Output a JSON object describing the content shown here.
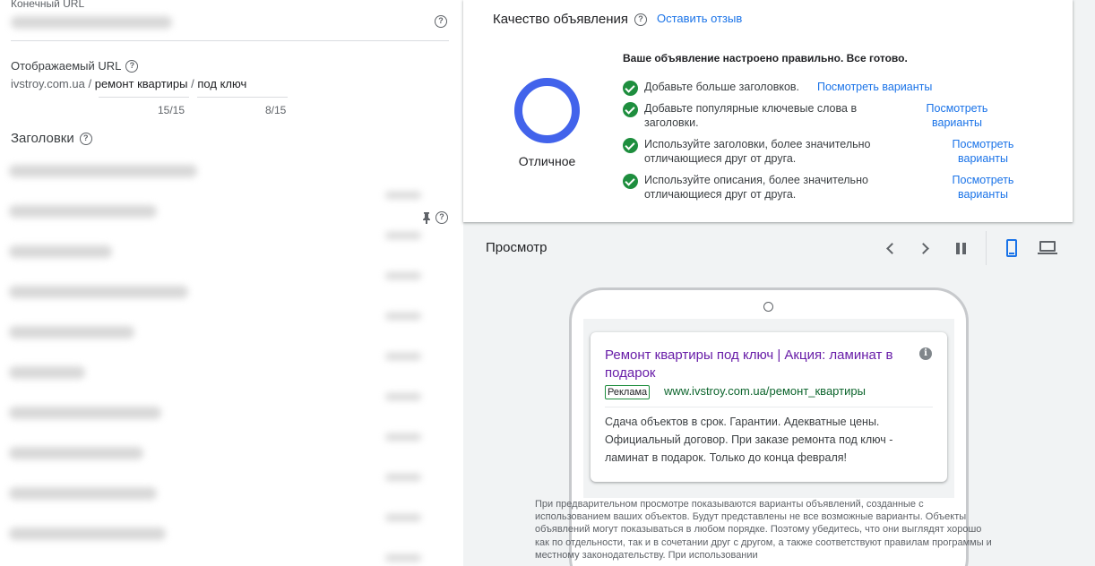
{
  "form": {
    "final_url_label": "Конечный URL",
    "display_url_label": "Отображаемый URL",
    "display_domain": "ivstroy.com.ua",
    "separator": "/",
    "path1": "ремонт квартиры",
    "path2": "под ключ",
    "path1_count": "15/15",
    "path2_count": "8/15",
    "headlines_label": "Заголовки"
  },
  "quality": {
    "title": "Качество объявления",
    "feedback_link": "Оставить отзыв",
    "rating": "Отличное",
    "heading": "Ваше объявление настроено правильно. Все готово.",
    "items": [
      {
        "text": "Добавьте больше заголовков.",
        "link": "Посмотреть варианты"
      },
      {
        "text": "Добавьте популярные ключевые слова в заголовки.",
        "link": "Посмотреть варианты"
      },
      {
        "text": "Используйте заголовки, более значительно отличающиеся друг от друга.",
        "link": "Посмотреть варианты"
      },
      {
        "text": "Используйте описания, более значительно отличающиеся друг от друга.",
        "link": "Посмотреть варианты"
      }
    ],
    "ring_color": "#4263eb",
    "check_color": "#1e8e3e"
  },
  "preview": {
    "title": "Просмотр",
    "controls": [
      "chevron-left-icon",
      "chevron-right-icon",
      "pause-icon",
      "mobile-icon",
      "laptop-icon"
    ],
    "ad": {
      "headline": "Ремонт квартиры под ключ | Акция: ламинат в подарок",
      "badge": "Реклама",
      "url": "www.ivstroy.com.ua/ремонт_квартиры",
      "description": "Сдача объектов в срок. Гарантии. Адекватные цены. Официальный договор. При заказе ремонта под ключ - ламинат в подарок. Только до конца февраля!"
    },
    "disclaimer": "При предварительном просмотре показываются варианты объявлений, созданные с использованием ваших объектов. Будут представлены не все возможные варианты. Объекты объявлений могут показываться в любом порядке. Поэтому убедитесь, что они выглядят хорошо как по отдельности, так и в сочетании друг с другом, а также соответствуют правилам программы и местному законодательству. При использовании"
  }
}
